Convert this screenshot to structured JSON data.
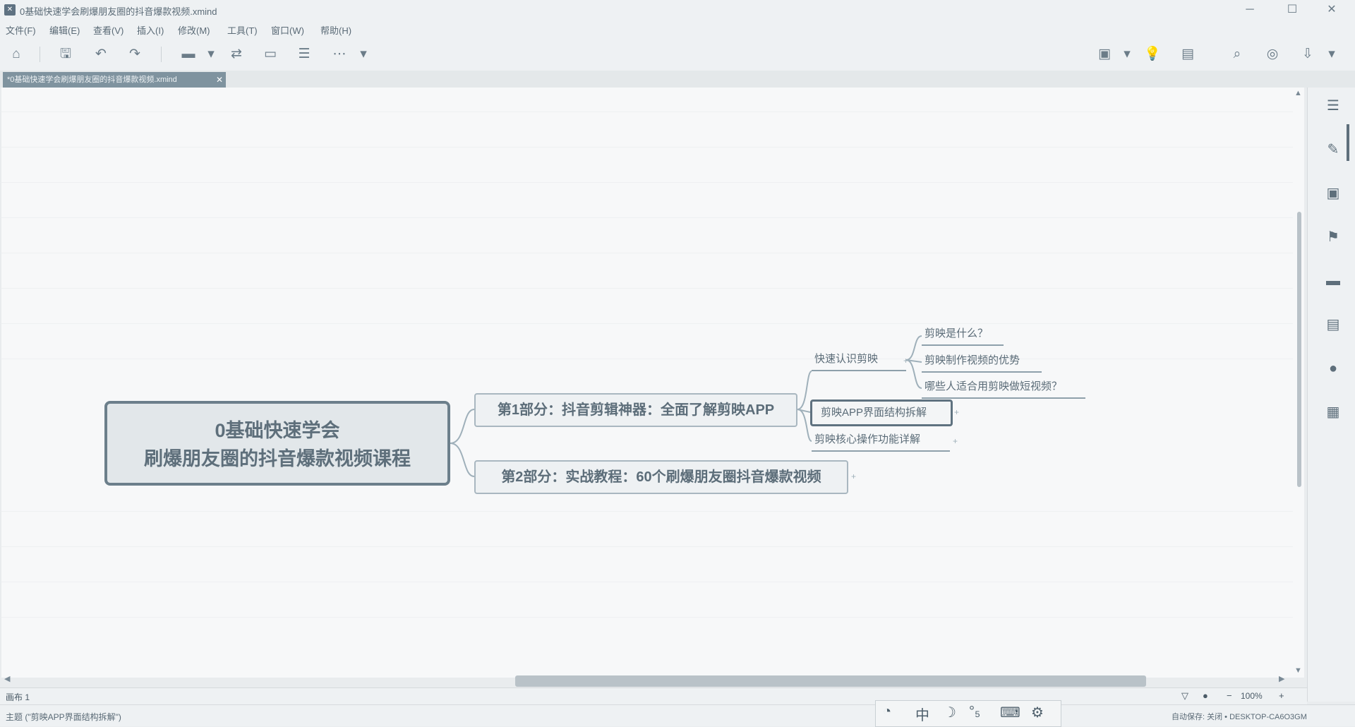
{
  "window": {
    "title": "0基础快速学会刷爆朋友圈的抖音爆款视频.xmind",
    "controls": {
      "minimize": "─",
      "maximize": "☐",
      "close": "✕"
    }
  },
  "menu": {
    "items": [
      "文件(F)",
      "编辑(E)",
      "查看(V)",
      "插入(I)",
      "修改(M)",
      "工具(T)",
      "窗口(W)",
      "帮助(H)"
    ]
  },
  "toolbar": {
    "home_icon": "⌂",
    "save_icon": "🖫",
    "undo_icon": "↶",
    "redo_icon": "↷",
    "topic_icon": "▬",
    "dropdown_icon": "▾",
    "relationship_icon": "⇄",
    "boundary_icon": "▭",
    "summary_icon": "☰",
    "more_icon": "⋯",
    "present_icon": "▣",
    "idea_icon": "💡",
    "share_icon": "▤",
    "search_icon": "⌕",
    "camera_icon": "◎",
    "export_icon": "⇩"
  },
  "tab": {
    "label": "*0基础快速学会刷爆朋友圈的抖音爆款视频.xmind",
    "close": "✕"
  },
  "mindmap": {
    "central": {
      "line1": "0基础快速学会",
      "line2": "刷爆朋友圈的抖音爆款视频课程"
    },
    "main_topics": [
      {
        "label": "第1部分：抖音剪辑神器：全面了解剪映APP"
      },
      {
        "label": "第2部分：实战教程：60个刷爆朋友圈抖音爆款视频"
      }
    ],
    "part1_subtopics": [
      {
        "label": "快速认识剪映"
      },
      {
        "label": "剪映APP界面结构拆解"
      },
      {
        "label": "剪映核心操作功能详解"
      }
    ],
    "leaf_topics": [
      {
        "label": "剪映是什么？"
      },
      {
        "label": "剪映制作视频的优势"
      },
      {
        "label": "哪些人适合用剪映做短视频？"
      }
    ],
    "collapse_marker": "+"
  },
  "right_panel": {
    "icons": [
      "outline-icon",
      "format-icon",
      "image-icon",
      "flag-icon",
      "markers-icon",
      "notes-icon",
      "comments-icon",
      "task-icon"
    ],
    "glyphs": [
      "☰",
      "✎",
      "▣",
      "⚑",
      "▬",
      "▤",
      "●",
      "▦"
    ]
  },
  "pathbar": {
    "label": "画布 1",
    "zoom": "100%",
    "filter_icon": "▽",
    "zoom_out": "−",
    "zoom_in": "+"
  },
  "statusbar": {
    "left": "主题 (\"剪映APP界面结构拆解\")",
    "right": "自动保存: 关闭 • DESKTOP-CA6O3GM"
  },
  "ime": {
    "glyphs": [
      "◔",
      "中",
      "☽",
      "°₅",
      "⌨",
      "⚙"
    ]
  }
}
